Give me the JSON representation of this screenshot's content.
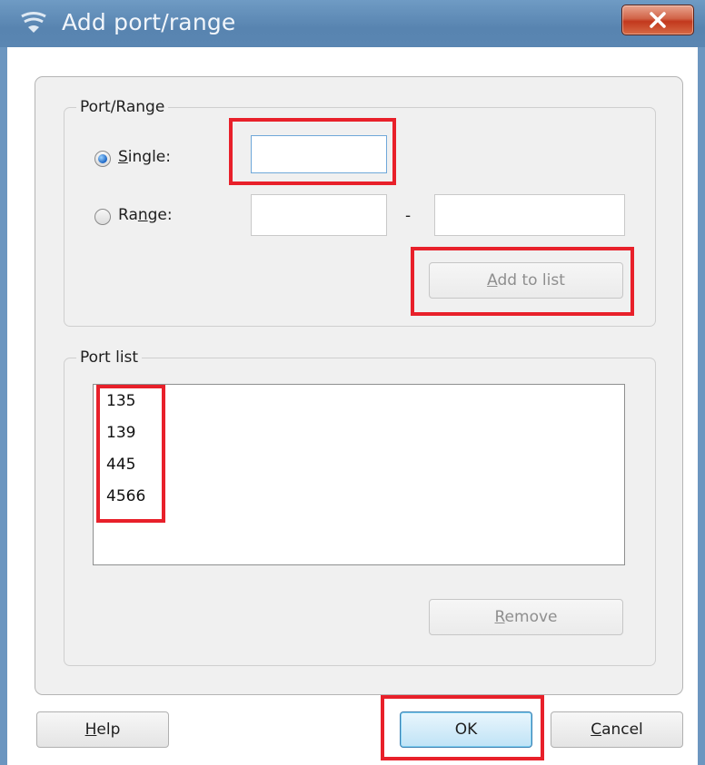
{
  "window": {
    "title": "Add port/range",
    "icon": "network-shield-icon"
  },
  "port_range_group": {
    "title": "Port/Range",
    "single": {
      "prefix": "",
      "accel": "S",
      "rest": "ingle:",
      "checked": true,
      "value": ""
    },
    "range": {
      "prefix": "Ra",
      "accel": "n",
      "rest": "ge:",
      "checked": false,
      "from": "",
      "to": ""
    },
    "separator": "-",
    "add_button": {
      "accel": "A",
      "rest": "dd to list",
      "enabled": false
    }
  },
  "port_list_group": {
    "title": "Port list",
    "items": [
      "135",
      "139",
      "445",
      "4566"
    ],
    "remove_button": {
      "accel": "R",
      "rest": "emove",
      "enabled": false
    }
  },
  "footer": {
    "help": {
      "accel": "H",
      "rest": "elp"
    },
    "ok": {
      "label": "OK"
    },
    "cancel": {
      "accel": "C",
      "rest": "ancel"
    }
  },
  "highlight_color": "#e8202a"
}
